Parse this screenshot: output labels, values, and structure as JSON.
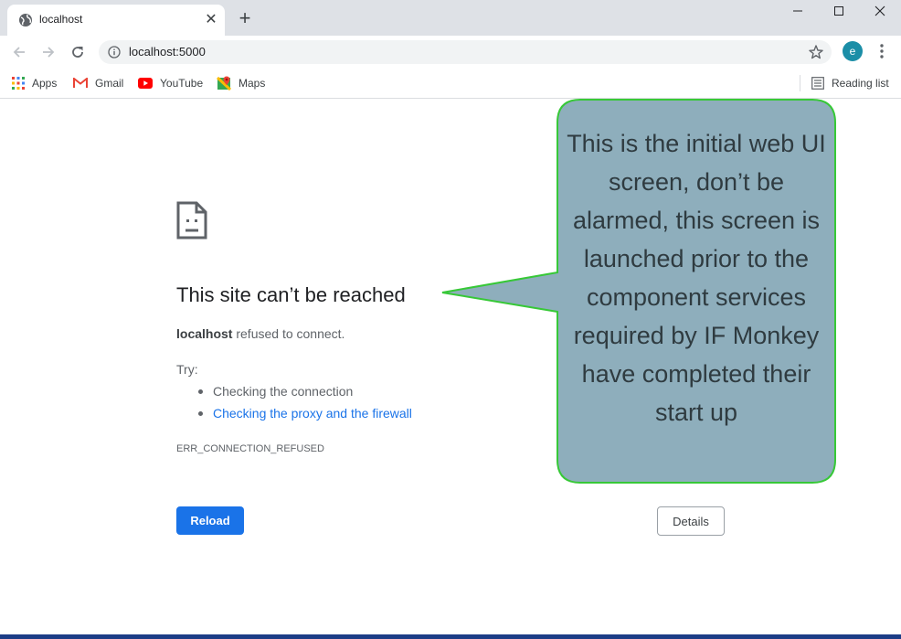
{
  "browser": {
    "tab": {
      "title": "localhost"
    },
    "address": {
      "url": "localhost:5000"
    },
    "profile": {
      "initial": "e"
    },
    "bookmarks": [
      {
        "label": "Apps",
        "icon": "apps-grid-icon"
      },
      {
        "label": "Gmail",
        "icon": "gmail-icon"
      },
      {
        "label": "YouTube",
        "icon": "youtube-icon"
      },
      {
        "label": "Maps",
        "icon": "maps-icon"
      }
    ],
    "reading_list": "Reading list"
  },
  "error_page": {
    "title": "This site can’t be reached",
    "host": "localhost",
    "message": " refused to connect.",
    "try_label": "Try:",
    "suggestions": [
      "Checking the connection",
      "Checking the proxy and the firewall"
    ],
    "error_code": "ERR_CONNECTION_REFUSED",
    "reload_label": "Reload",
    "details_label": "Details"
  },
  "callout": {
    "text": "This is the initial web UI screen, don’t be alarmed, this screen is launched prior to the component services required by IF Monkey have completed their start up"
  },
  "colors": {
    "accent": "#1a73e8",
    "callout_fill": "#8eaebc",
    "callout_border": "#37c837"
  }
}
